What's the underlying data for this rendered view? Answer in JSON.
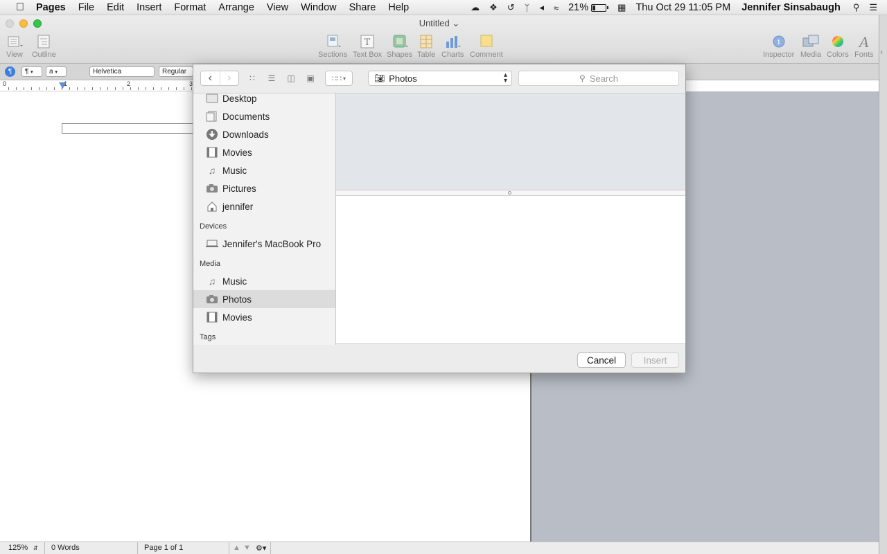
{
  "menubar": {
    "app_name": "Pages",
    "menus": [
      "File",
      "Edit",
      "Insert",
      "Format",
      "Arrange",
      "View",
      "Window",
      "Share",
      "Help"
    ],
    "battery": "21%",
    "battery_level": 0.21,
    "datetime": "Thu Oct 29  11:05 PM",
    "user": "Jennifer Sinsabaugh"
  },
  "window": {
    "title": "Untitled",
    "toolbar": {
      "view": "View",
      "outline": "Outline",
      "sections": "Sections",
      "text_box": "Text Box",
      "shapes": "Shapes",
      "table": "Table",
      "charts": "Charts",
      "comment": "Comment",
      "inspector": "Inspector",
      "media": "Media",
      "colors": "Colors",
      "fonts": "Fonts"
    }
  },
  "format_bar": {
    "paragraph_style": "¶",
    "char_style": "a",
    "font": "Helvetica",
    "typeface": "Regular"
  },
  "ruler": {
    "labels": [
      "0",
      "1",
      "2",
      "3"
    ]
  },
  "status_bar": {
    "zoom": "125%",
    "words": "0 Words",
    "page": "Page 1 of 1"
  },
  "dialog": {
    "location": "Photos",
    "search_placeholder": "Search",
    "favorites": [
      {
        "label": "Desktop",
        "icon": "desktop-folder-icon"
      },
      {
        "label": "Documents",
        "icon": "documents-folder-icon"
      },
      {
        "label": "Downloads",
        "icon": "downloads-icon"
      },
      {
        "label": "Movies",
        "icon": "film-icon"
      },
      {
        "label": "Music",
        "icon": "music-note-icon"
      },
      {
        "label": "Pictures",
        "icon": "camera-icon"
      },
      {
        "label": "jennifer",
        "icon": "home-icon"
      }
    ],
    "devices_header": "Devices",
    "devices": [
      {
        "label": "Jennifer's MacBook Pro",
        "icon": "laptop-icon"
      }
    ],
    "media_header": "Media",
    "media": [
      {
        "label": "Music",
        "icon": "music-note-icon"
      },
      {
        "label": "Photos",
        "icon": "camera-icon",
        "selected": true
      },
      {
        "label": "Movies",
        "icon": "film-icon"
      }
    ],
    "tags_header": "Tags",
    "cancel": "Cancel",
    "insert": "Insert"
  }
}
